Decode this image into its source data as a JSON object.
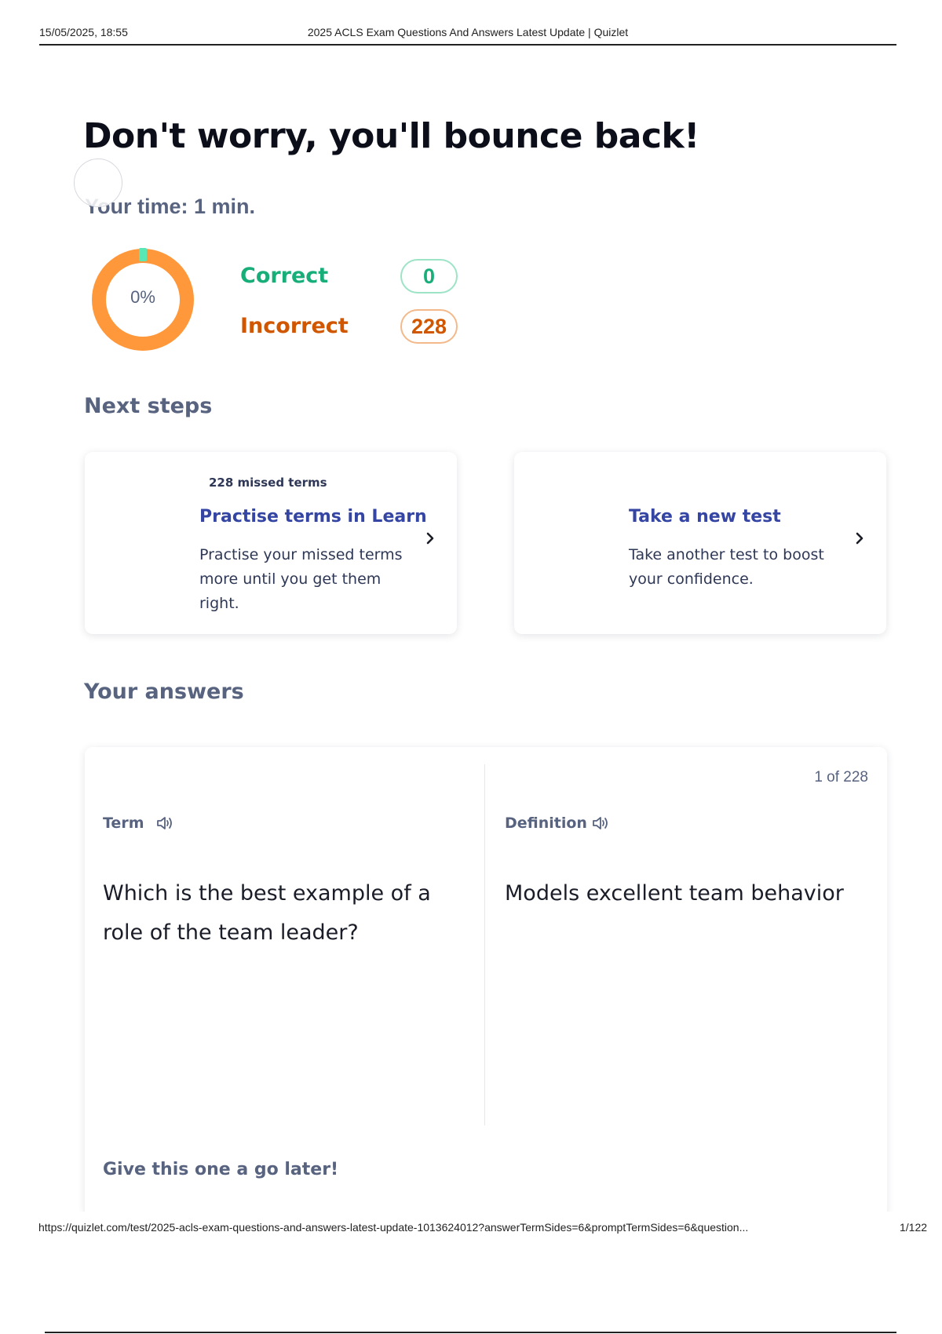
{
  "print_header": {
    "date": "15/05/2025, 18:55",
    "title": "2025 ACLS Exam Questions And Answers Latest Update | Quizlet"
  },
  "results": {
    "heading": "Don't worry, you'll bounce back!",
    "time": "Your time: 1 min.",
    "score_percent_label": "0%",
    "score_fraction": 0,
    "correct_label": "Correct",
    "correct_count": "0",
    "incorrect_label": "Incorrect",
    "incorrect_count": "228"
  },
  "next_steps": {
    "heading": "Next steps",
    "cards": [
      {
        "eyebrow": "228 missed terms",
        "title": "Practise terms in Learn",
        "description": "Practise your missed terms more until you get them right."
      },
      {
        "title": "Take a new test",
        "description": "Take another test to boost your confidence."
      }
    ]
  },
  "answers": {
    "heading": "Your answers",
    "counter": "1 of 228",
    "term_label": "Term",
    "definition_label": "Definition",
    "term": "Which is the best example of a role of the team leader?",
    "definition": "Models excellent team behavior",
    "prompt": "Give this one a go later!"
  },
  "print_footer": {
    "url": "https://quizlet.com/test/2025-acls-exam-questions-and-answers-latest-update-1013624012?answerTermSides=6&promptTermSides=6&question...",
    "page": "1/122"
  },
  "colors": {
    "correct": "#18ae79",
    "incorrect": "#d05700",
    "donut_incorrect": "#ff983a",
    "donut_correct": "#59e8b5",
    "link_title": "#3545a3",
    "muted_text": "#586380"
  },
  "icons": [
    "chevron-right-icon",
    "audio-icon",
    "loading-spinner"
  ]
}
